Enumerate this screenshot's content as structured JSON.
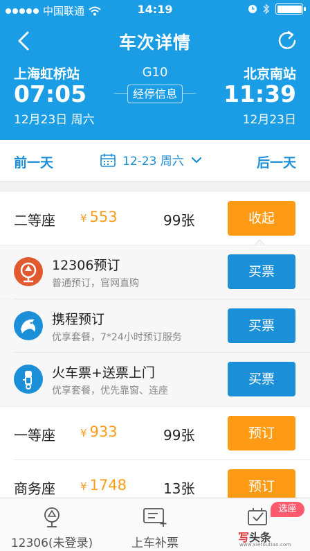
{
  "status_bar": {
    "carrier": "中国联通",
    "time": "14:19"
  },
  "nav": {
    "title": "车次详情"
  },
  "route": {
    "from_station": "上海虹桥站",
    "from_time": "07:05",
    "from_date": "12月23日 周六",
    "to_station": "北京南站",
    "to_time": "11:39",
    "to_date": "12月23日",
    "train_no": "G10",
    "stops_label": "经停信息"
  },
  "date_bar": {
    "prev_label": "前一天",
    "current_date": "12-23 周六",
    "next_label": "后一天"
  },
  "seats": [
    {
      "name": "二等座",
      "currency": "¥",
      "price": "553",
      "count": "99张",
      "action": "收起"
    },
    {
      "name": "一等座",
      "currency": "¥",
      "price": "933",
      "count": "99张",
      "action": "预订"
    },
    {
      "name": "商务座",
      "currency": "¥",
      "price": "1748",
      "count": "13张",
      "action": "预订"
    }
  ],
  "providers": [
    {
      "title": "12306预订",
      "subtitle": "普通预订，官网直购",
      "action": "买票",
      "icon": "railway-logo-icon",
      "color": "#e0592f"
    },
    {
      "title": "携程预订",
      "subtitle": "优享套餐，7*24小时预订服务",
      "action": "买票",
      "icon": "dolphin-logo-icon",
      "color": "#1b8fd8"
    },
    {
      "title": "火车票+送票上门",
      "subtitle": "优享套餐，优先靠窗、连座",
      "action": "买票",
      "icon": "courier-icon",
      "color": "#1b8fd8"
    }
  ],
  "tabs": [
    {
      "label": "12306(未登录)",
      "icon": "railway-icon"
    },
    {
      "label": "上车补票",
      "icon": "add-ticket-icon"
    },
    {
      "label": "",
      "icon": "seat-select-icon"
    }
  ],
  "badge": "选座",
  "watermark": {
    "brand_red": "写",
    "brand": "头条",
    "url": "www.xietoutiao.com"
  },
  "colors": {
    "primary": "#1b9de6",
    "accent": "#ff9a14",
    "button_blue": "#1b8fd8"
  }
}
